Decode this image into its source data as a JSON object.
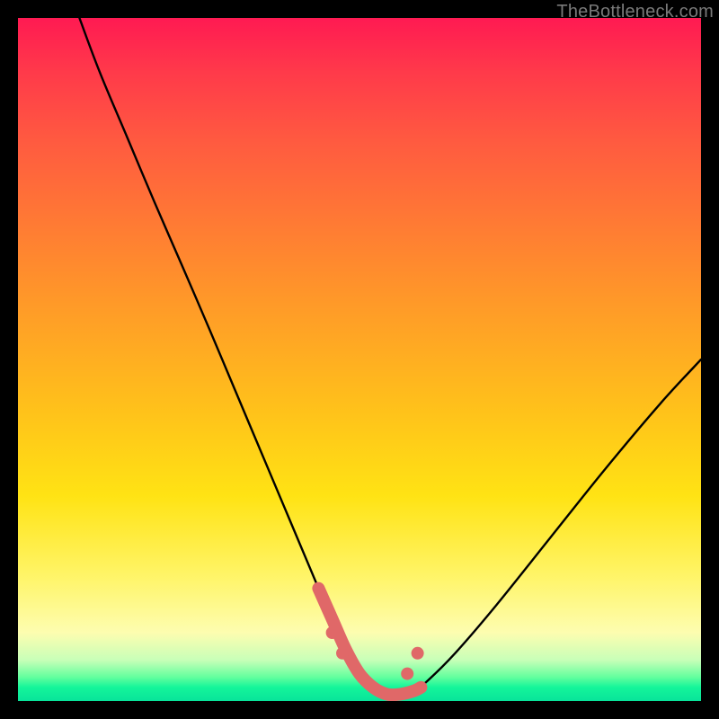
{
  "watermark": "TheBottleneck.com",
  "chart_data": {
    "type": "line",
    "title": "",
    "xlabel": "",
    "ylabel": "",
    "xlim": [
      0,
      100
    ],
    "ylim": [
      0,
      100
    ],
    "series": [
      {
        "name": "bottleneck-curve",
        "x": [
          9,
          12,
          16,
          20,
          24,
          28,
          32,
          36,
          40,
          44,
          46,
          48,
          50,
          52,
          54,
          56,
          58,
          60,
          64,
          70,
          78,
          86,
          94,
          100
        ],
        "values": [
          100,
          92,
          82.5,
          73,
          63.8,
          54.5,
          45,
          35.5,
          26,
          16.5,
          12,
          7.5,
          4,
          2,
          1,
          1,
          1.5,
          3,
          7,
          14,
          24,
          34,
          43.5,
          50
        ]
      },
      {
        "name": "highlight-segment",
        "x": [
          44,
          46,
          48,
          50,
          52,
          54,
          56,
          58,
          59
        ],
        "values": [
          16.5,
          12,
          7.5,
          4,
          2,
          1,
          1,
          1.5,
          2
        ]
      }
    ],
    "highlight_dots": {
      "x": [
        46,
        47.5,
        57,
        58.5
      ],
      "values": [
        10,
        7,
        4,
        7
      ]
    }
  }
}
